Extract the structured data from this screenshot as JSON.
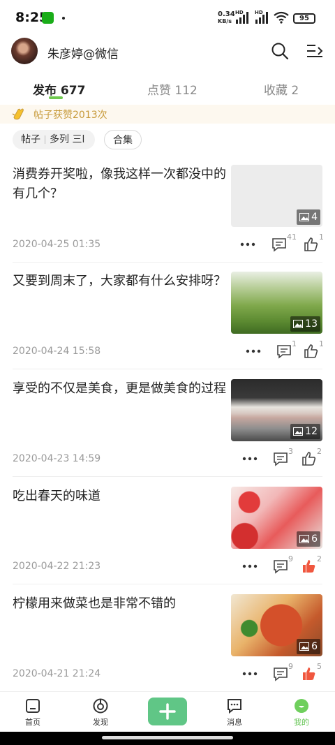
{
  "status_bar": {
    "time": "8:25",
    "net_speed_value": "0.34",
    "net_speed_unit": "KB/s",
    "hd1": "HD",
    "hd2": "HD",
    "battery": "95"
  },
  "header": {
    "username": "朱彦婷@微信"
  },
  "tabs": [
    {
      "label": "发布 677"
    },
    {
      "label": "点赞 112"
    },
    {
      "label": "收藏 2"
    }
  ],
  "likes_banner": {
    "text": "帖子获赞2013次"
  },
  "filters": {
    "chip1_a": "帖子",
    "chip1_b": "多列 三l",
    "chip2": "合集"
  },
  "posts": [
    {
      "title": "消费券开奖啦，像我这样一次都没中的有几个？",
      "date": "2020-04-25 01:35",
      "image_count": "4",
      "comments": "41",
      "likes": "1",
      "liked": false
    },
    {
      "title": "又要到周末了，大家都有什么安排呀？",
      "date": "2020-04-24 15:58",
      "image_count": "13",
      "comments": "1",
      "likes": "1",
      "liked": false
    },
    {
      "title": "享受的不仅是美食，更是做美食的过程",
      "date": "2020-04-23 14:59",
      "image_count": "12",
      "comments": "3",
      "likes": "2",
      "liked": false
    },
    {
      "title": "吃出春天的味道",
      "date": "2020-04-22 21:23",
      "image_count": "6",
      "comments": "9",
      "likes": "2",
      "liked": true
    },
    {
      "title": "柠檬用来做菜也是非常不错的",
      "date": "2020-04-21 21:24",
      "image_count": "6",
      "comments": "9",
      "likes": "5",
      "liked": true
    }
  ],
  "bottom_nav": [
    {
      "label": "首页"
    },
    {
      "label": "发现"
    },
    {
      "label": "消息"
    },
    {
      "label": "我的"
    }
  ],
  "colors": {
    "accent": "#62c451",
    "plus_button": "#60c686",
    "liked": "#f0573f",
    "banner_text": "#c79a3a"
  }
}
